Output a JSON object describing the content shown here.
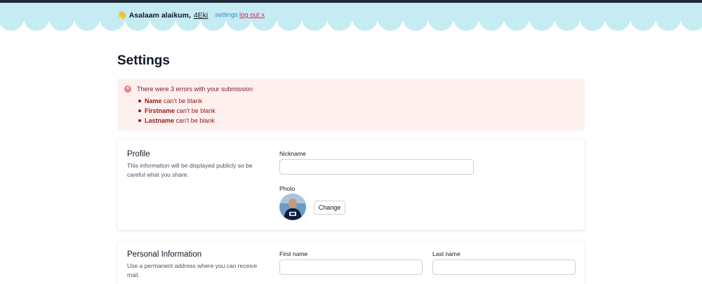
{
  "header": {
    "wave_emoji": "👋",
    "greeting": "Asalaam alaikum,",
    "username": "4Eki",
    "settings_link": "settings",
    "logout_link": "log out x",
    "cloud_color": "#c5ecf2"
  },
  "page": {
    "title": "Settings"
  },
  "alert": {
    "title": "There were 3 errors with your submission",
    "errors": [
      {
        "field": "Name",
        "message": "can't be blank"
      },
      {
        "field": "Firstname",
        "message": "can't be blank"
      },
      {
        "field": "Lastname",
        "message": "can't be blank"
      }
    ],
    "icon": "x-circle-icon"
  },
  "profile": {
    "title": "Profile",
    "description": "This information will be displayed publicly so be careful what you share.",
    "nickname_label": "Nickname",
    "nickname_value": "",
    "photo_label": "Photo",
    "change_button": "Change"
  },
  "personal": {
    "title": "Personal Information",
    "description": "Use a permanent address where you can receive mail.",
    "first_name_label": "First name",
    "first_name_value": "",
    "last_name_label": "Last name",
    "last_name_value": ""
  }
}
